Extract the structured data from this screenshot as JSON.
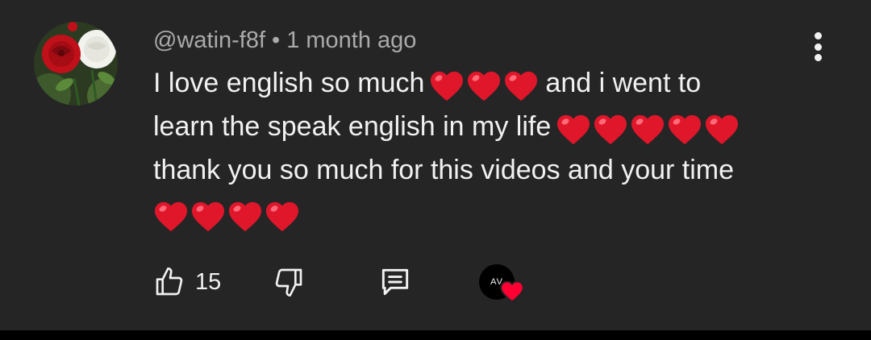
{
  "comment": {
    "author_handle": "@watin-f8f",
    "separator": "•",
    "timestamp": "1 month ago",
    "lines": [
      {
        "before": "I love english so much",
        "hearts": 3,
        "after": "and i went to"
      },
      {
        "before": "learn the speak english in my life",
        "hearts": 5,
        "after": ""
      },
      {
        "before": "thank you so much for this videos and your time",
        "hearts": 0,
        "after": ""
      },
      {
        "before": "",
        "hearts": 4,
        "after": ""
      }
    ],
    "heart_color": "#e0162b"
  },
  "actions": {
    "like_count": "15"
  },
  "creator": {
    "avatar_text": "AV",
    "heart_color": "#ff0033"
  },
  "colors": {
    "background": "#252525",
    "text": "#f1f1f1",
    "meta_text": "#aaaaaa"
  }
}
